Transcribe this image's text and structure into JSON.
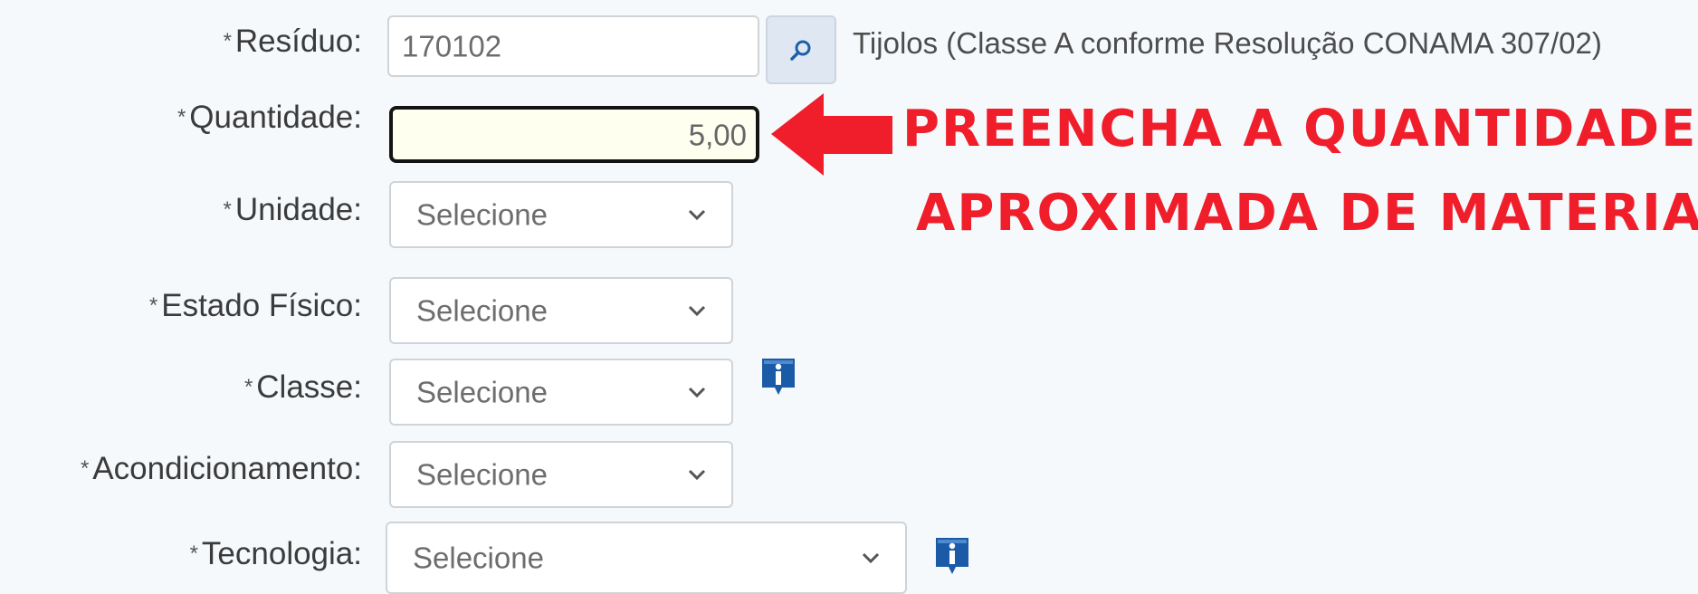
{
  "form": {
    "residuo": {
      "label": "Resíduo:",
      "value": "170102",
      "description": "Tijolos (Classe A conforme Resolução CONAMA 307/02)"
    },
    "quantidade": {
      "label": "Quantidade:",
      "value": "5,00"
    },
    "unidade": {
      "label": "Unidade:",
      "value": "Selecione"
    },
    "estado_fisico": {
      "label": "Estado Físico:",
      "value": "Selecione"
    },
    "classe": {
      "label": "Classe:",
      "value": "Selecione"
    },
    "acondicionamento": {
      "label": "Acondicionamento:",
      "value": "Selecione"
    },
    "tecnologia": {
      "label": "Tecnologia:",
      "value": "Selecione"
    },
    "required_marker": "*"
  },
  "annotation": {
    "line1": "PREENCHA A QUANTIDADE",
    "line2": "APROXIMADA DE MATERIAL",
    "color": "#f01e2b"
  },
  "icons": {
    "lookup": "search-icon",
    "info": "info-icon",
    "dropdown": "chevron-down-icon",
    "arrow": "arrow-left-icon"
  }
}
